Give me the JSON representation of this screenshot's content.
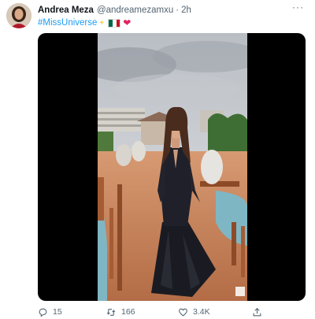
{
  "tweet": {
    "author_name": "Andrea Meza",
    "author_handle": "@andreamezamxu",
    "separator": "·",
    "time": "2h",
    "hashtag": "#MissUniverse",
    "sparkle": "+",
    "heart": "❤",
    "more_icon": "···"
  },
  "media": {
    "type": "video",
    "colors": {
      "letterbox": "#000000",
      "deck": "#c98a64",
      "sky": "#c9cdd2",
      "dress": "#1a1b22"
    }
  },
  "actions": {
    "reply_count": "15",
    "retweet_count": "166",
    "like_count": "3.4K"
  },
  "colors": {
    "accent": "#1d9bf0",
    "muted": "#536471",
    "text": "#0f1419"
  }
}
